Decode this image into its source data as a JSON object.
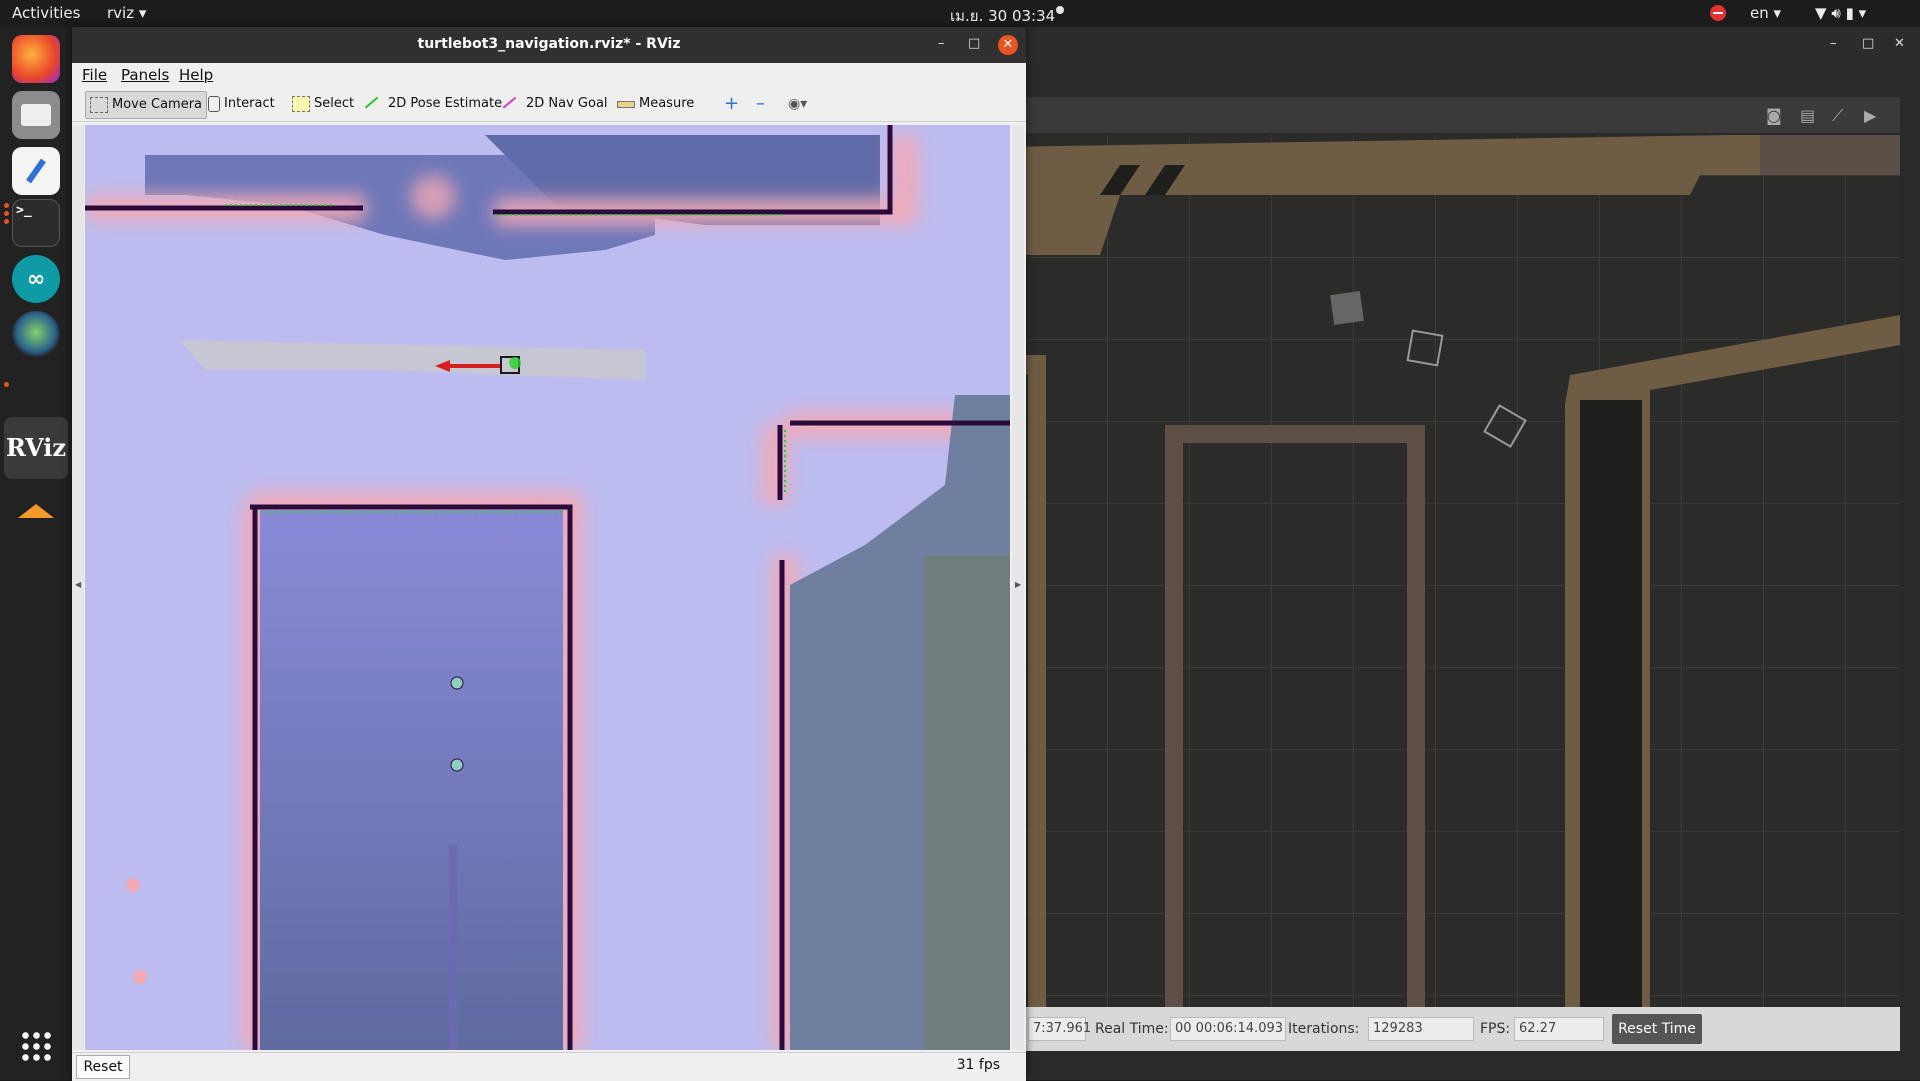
{
  "topbar": {
    "activities": "Activities",
    "app_menu": "rviz",
    "clock": "เม.ย. 30  03:34",
    "language": "en"
  },
  "dock": {
    "items": [
      {
        "name": "firefox-icon",
        "label": ""
      },
      {
        "name": "files-icon",
        "label": ""
      },
      {
        "name": "text-editor-icon",
        "label": ""
      },
      {
        "name": "terminal-icon",
        "label": ">_"
      },
      {
        "name": "arduino-icon",
        "label": ""
      },
      {
        "name": "gazebo-icon",
        "label": ""
      },
      {
        "name": "rviz-icon",
        "label": "RViz"
      },
      {
        "name": "ros-tool-icon",
        "label": ""
      }
    ]
  },
  "rviz": {
    "title": "turtlebot3_navigation.rviz* - RViz",
    "menu": [
      "File",
      "Panels",
      "Help"
    ],
    "tools": [
      "Move Camera",
      "Interact",
      "Select",
      "2D Pose Estimate",
      "2D Nav Goal",
      "Measure"
    ],
    "reset": "Reset",
    "fps": "31 fps"
  },
  "gazebo": {
    "status": {
      "sim_time_value": "7:37.961",
      "real_time_label": "Real Time:",
      "real_time_value": "00 00:06:14.093",
      "iterations_label": "Iterations:",
      "iterations_value": "129283",
      "fps_label": "FPS:",
      "fps_value": "62.27",
      "reset_time": "Reset Time"
    }
  },
  "colors": {
    "accent": "#e95420",
    "map_free": "#bcbcf0",
    "map_wall": "#2a0a3a",
    "gazebo_wall": "#6e5c45"
  }
}
